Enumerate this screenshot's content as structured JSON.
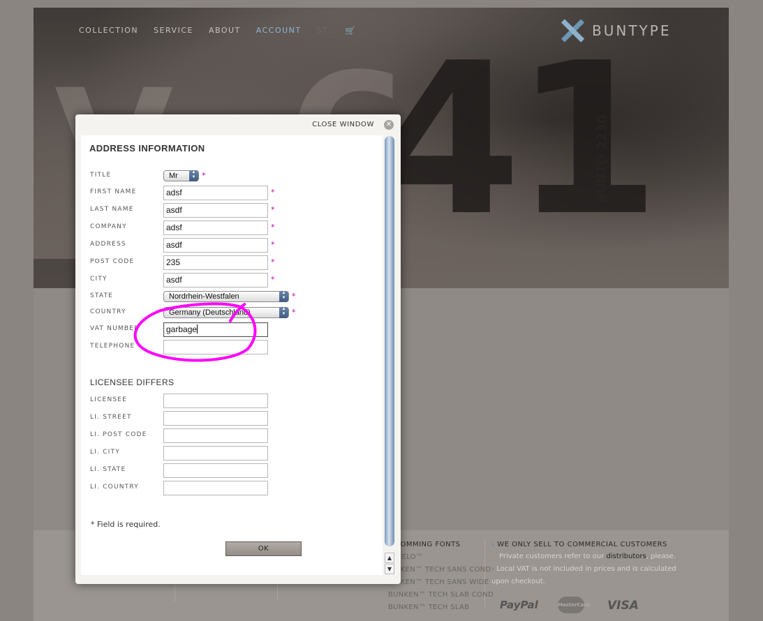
{
  "nav": {
    "items": [
      "COLLECTION",
      "SERVICE",
      "ABOUT",
      "ACCOUNT",
      "ST..."
    ],
    "active": "ACCOUNT"
  },
  "logo": {
    "text": "BUNTYPE"
  },
  "hero": {
    "big_text": "41",
    "vertical_text": "BUNTO 2230"
  },
  "modal": {
    "close_label": "CLOSE WINDOW",
    "section1_title": "ADDRESS INFORMATION",
    "fields": {
      "title": {
        "label": "TITLE",
        "value": "Mr"
      },
      "first_name": {
        "label": "FIRST NAME",
        "value": "adsf"
      },
      "last_name": {
        "label": "LAST NAME",
        "value": "asdf"
      },
      "company": {
        "label": "COMPANY",
        "value": "adsf"
      },
      "address": {
        "label": "ADDRESS",
        "value": "asdf"
      },
      "post_code": {
        "label": "POST CODE",
        "value": "235"
      },
      "city": {
        "label": "CITY",
        "value": "asdf"
      },
      "state": {
        "label": "STATE",
        "value": "Nordrhein-Westfalen"
      },
      "country": {
        "label": "COUNTRY",
        "value": "Germany (Deutschland)"
      },
      "vat_number": {
        "label": "VAT NUMBER",
        "value": "garbage"
      },
      "telephone": {
        "label": "TELEPHONE",
        "value": ""
      }
    },
    "required_mark": "*",
    "section2_title": "LICENSEE DIFFERS",
    "licensee_fields": {
      "licensee": {
        "label": "LICENSEE",
        "value": ""
      },
      "street": {
        "label": "LI. STREET",
        "value": ""
      },
      "post_code": {
        "label": "LI. POST CODE",
        "value": ""
      },
      "city": {
        "label": "LI. CITY",
        "value": ""
      },
      "state": {
        "label": "LI. STATE",
        "value": ""
      },
      "country": {
        "label": "LI. COUNTRY",
        "value": ""
      }
    },
    "note": "* Field is required.",
    "ok_label": "OK"
  },
  "footer": {
    "upcoming_title": "COMMING FONTS",
    "upcoming_items": [
      "UELO™",
      "NKEN™ TECH SANS COND",
      "NKEN™ TECH SANS WIDE",
      "BUNKEN™ TECH SLAB COND",
      "BUNKEN™ TECH SLAB"
    ],
    "commercial_title": "WE ONLY SELL TO COMMERCIAL CUSTOMERS",
    "commercial_text_pre": "Private customers refer to our ",
    "commercial_link": "distributors",
    "commercial_text_post": ", please.",
    "vat_text": "Local VAT is not included in prices and is calculated upon checkout.",
    "payment_logos": [
      "PayPal",
      "MasterCard",
      "VISA"
    ]
  },
  "colors": {
    "accent_blue": "#8fb6d2",
    "required_magenta": "#c000b0",
    "annotation_magenta": "#ff00ff"
  }
}
